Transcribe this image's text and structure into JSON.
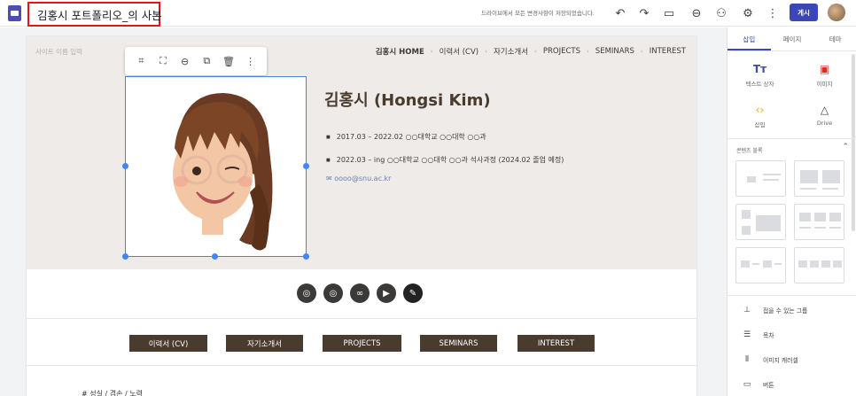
{
  "topbar": {
    "title": "김홍시 포트폴리오_의 사본",
    "saved_status": "드라이브에서 모든 변경사항이 저장되었습니다.",
    "publish_label": "게시",
    "colors": {
      "publish": "#3b47b8",
      "title_highlight": "#ee1111"
    },
    "icons": [
      "undo-icon",
      "redo-icon",
      "preview-icon",
      "link-icon",
      "share-icon",
      "settings-icon",
      "more-icon"
    ]
  },
  "site": {
    "name_placeholder": "사이트 이름 입력",
    "nav": [
      "김홍시 HOME",
      "이력서 (CV)",
      "자기소개서",
      "PROJECTS",
      "SEMINARS",
      "INTEREST"
    ],
    "hero_title": "김홍시 (Hongsi Kim)",
    "bullets": [
      "2017.03 – 2022.02 ○○대학교 ○○대학 ○○과",
      "2022.03 – ing ○○대학교 ○○대학 ○○과 석사과정 (2024.02 졸업 예정)"
    ],
    "email": "oooo@snu.ac.kr",
    "buttons": [
      "이력서 (CV)",
      "자기소개서",
      "PROJECTS",
      "SEMINARS",
      "INTEREST"
    ],
    "footer_text": "# 성실 / 겸손 / 노력",
    "colors": {
      "hero_bg": "#eeebe8",
      "button": "#4a3b2f",
      "title": "#4a3b2f"
    }
  },
  "panel": {
    "tabs": [
      "삽입",
      "페이지",
      "테마"
    ],
    "insert_items": [
      "텍스트 상자",
      "이미지",
      "삽입",
      "Drive"
    ],
    "blocks_title": "콘텐츠 블록",
    "list_items": [
      "접을 수 있는 그룹",
      "목차",
      "이미지 캐러셀",
      "버튼"
    ]
  }
}
